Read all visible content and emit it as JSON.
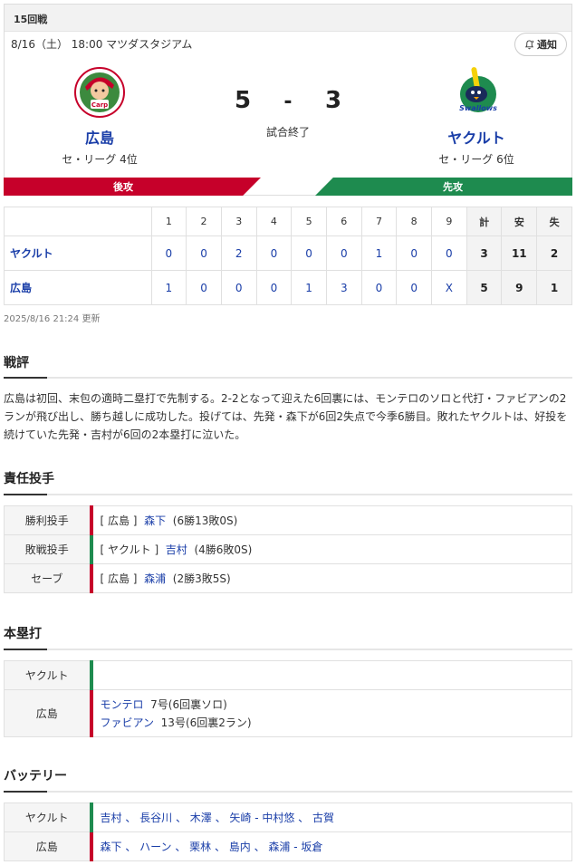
{
  "header": {
    "round": "15回戦"
  },
  "game": {
    "datetime": "8/16（土） 18:00 マツダスタジアム",
    "notify_label": "通知",
    "home": {
      "name": "広島",
      "rank": "セ・リーグ 4位",
      "score": "5",
      "side_label": "後攻",
      "color": "#c6002a"
    },
    "away": {
      "name": "ヤクルト",
      "rank": "セ・リーグ 6位",
      "score": "3",
      "side_label": "先攻",
      "color": "#1e8b4f"
    },
    "dash": "-",
    "status": "試合終了"
  },
  "linescore": {
    "headers": [
      "1",
      "2",
      "3",
      "4",
      "5",
      "6",
      "7",
      "8",
      "9",
      "計",
      "安",
      "失"
    ],
    "rows": [
      {
        "team": "ヤクルト",
        "innings": [
          "0",
          "0",
          "2",
          "0",
          "0",
          "0",
          "1",
          "0",
          "0"
        ],
        "runs": "3",
        "hits": "11",
        "errors": "2"
      },
      {
        "team": "広島",
        "innings": [
          "1",
          "0",
          "0",
          "0",
          "1",
          "3",
          "0",
          "0",
          "X"
        ],
        "runs": "5",
        "hits": "9",
        "errors": "1"
      }
    ],
    "updated": "2025/8/16 21:24 更新"
  },
  "review": {
    "title": "戦評",
    "text": "広島は初回、末包の適時二塁打で先制する。2-2となって迎えた6回裏には、モンテロのソロと代打・ファビアンの2ランが飛び出し、勝ち越しに成功した。投げては、先発・森下が6回2失点で今季6勝目。敗れたヤクルトは、好投を続けていた先発・吉村が6回の2本塁打に泣いた。"
  },
  "pitchers": {
    "title": "責任投手",
    "rows": [
      {
        "label": "勝利投手",
        "team": "[ 広島 ]",
        "name": "森下",
        "record": "(6勝13敗0S)"
      },
      {
        "label": "敗戦投手",
        "team": "[ ヤクルト ]",
        "name": "吉村",
        "record": "(4勝6敗0S)"
      },
      {
        "label": "セーブ",
        "team": "[ 広島 ]",
        "name": "森浦",
        "record": "(2勝3敗5S)"
      }
    ]
  },
  "homeruns": {
    "title": "本塁打",
    "away_label": "ヤクルト",
    "home_label": "広島",
    "home_list": [
      {
        "name": "モンテロ",
        "detail": "7号(6回裏ソロ)"
      },
      {
        "name": "ファビアン",
        "detail": "13号(6回裏2ラン)"
      }
    ]
  },
  "battery": {
    "title": "バッテリー",
    "away_label": "ヤクルト",
    "away_text": "吉村 、 長谷川 、 木澤 、 矢崎 ‐ 中村悠 、 古賀",
    "home_label": "広島",
    "home_text": "森下 、 ハーン 、 栗林 、 島内 、 森浦 ‐ 坂倉"
  }
}
